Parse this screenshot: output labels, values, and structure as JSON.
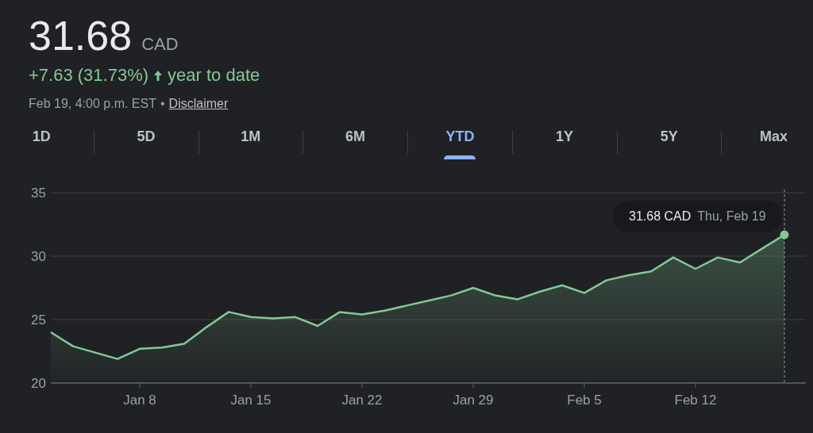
{
  "quote": {
    "price": "31.68",
    "currency": "CAD",
    "change": "+7.63 (31.73%)",
    "period": "year to date",
    "timestamp": "Feb 19, 4:00 p.m. EST",
    "separator": "•",
    "disclaimer": "Disclaimer"
  },
  "tabs": [
    {
      "label": "1D",
      "selected": false
    },
    {
      "label": "5D",
      "selected": false
    },
    {
      "label": "1M",
      "selected": false
    },
    {
      "label": "6M",
      "selected": false
    },
    {
      "label": "YTD",
      "selected": true
    },
    {
      "label": "1Y",
      "selected": false
    },
    {
      "label": "5Y",
      "selected": false
    },
    {
      "label": "Max",
      "selected": false
    }
  ],
  "chart": {
    "tooltip": {
      "price": "31.68 CAD",
      "date": "Thu, Feb 19"
    },
    "chart_data": {
      "type": "area",
      "categories": [
        null,
        null,
        null,
        null,
        "Jan 8",
        null,
        null,
        null,
        null,
        "Jan 15",
        null,
        null,
        null,
        null,
        "Jan 22",
        null,
        null,
        null,
        null,
        "Jan 29",
        null,
        null,
        null,
        null,
        "Feb 5",
        null,
        null,
        null,
        null,
        "Feb 12",
        null,
        null,
        null,
        null
      ],
      "series": [
        {
          "color": "#81c995",
          "values": [
            24.0,
            22.9,
            22.4,
            21.9,
            22.7,
            22.8,
            23.1,
            24.4,
            25.6,
            25.2,
            25.1,
            25.2,
            24.5,
            25.6,
            25.4,
            25.7,
            26.1,
            26.5,
            26.9,
            27.5,
            26.9,
            26.6,
            27.2,
            27.7,
            27.1,
            28.1,
            28.5,
            28.8,
            29.9,
            29.0,
            29.9,
            29.5,
            30.6,
            31.68
          ]
        }
      ],
      "ylim": [
        20,
        35
      ],
      "yticks": [
        20,
        25,
        30,
        35
      ]
    }
  }
}
